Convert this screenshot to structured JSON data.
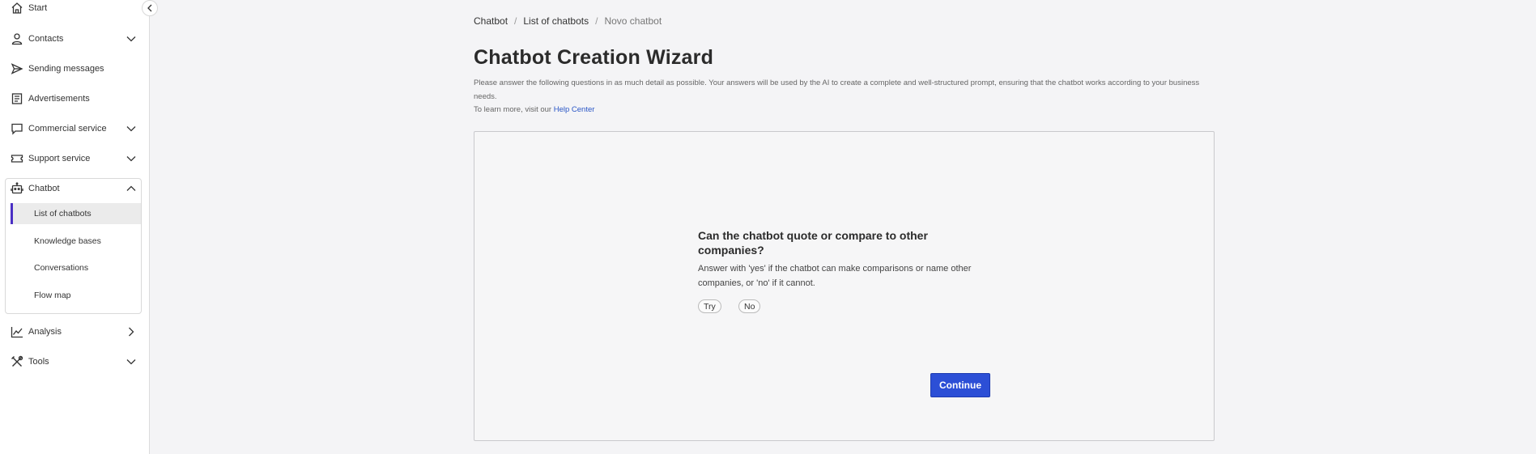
{
  "sidebar": {
    "items": [
      {
        "label": "Start",
        "icon": "home-icon"
      },
      {
        "label": "Contacts",
        "icon": "user-icon"
      },
      {
        "label": "Sending messages",
        "icon": "send-icon"
      },
      {
        "label": "Advertisements",
        "icon": "document-icon"
      },
      {
        "label": "Commercial service",
        "icon": "chat-icon"
      },
      {
        "label": "Support service",
        "icon": "ticket-icon"
      },
      {
        "label": "Chatbot",
        "icon": "robot-icon"
      },
      {
        "label": "Analysis",
        "icon": "chart-icon"
      },
      {
        "label": "Tools",
        "icon": "tools-icon"
      }
    ],
    "chatbot_subitems": [
      {
        "label": "List of chatbots",
        "active": true
      },
      {
        "label": "Knowledge bases"
      },
      {
        "label": "Conversations"
      },
      {
        "label": "Flow map"
      }
    ]
  },
  "breadcrumb": [
    "Chatbot",
    "List of chatbots",
    "Novo chatbot"
  ],
  "main": {
    "title": "Chatbot Creation Wizard",
    "intro_line1": "Please answer the following questions in as much detail as possible. Your answers will be used by the AI to create a complete and well-structured prompt, ensuring that the chatbot works according to your business needs.",
    "intro_line2_prefix": "To learn more, visit our",
    "help_link": "Help Center"
  },
  "wizard": {
    "question": "Can the chatbot quote or compare to other companies?",
    "hint": "Answer with 'yes' if the chatbot can make comparisons or name other companies, or 'no' if it cannot.",
    "options": [
      "Try",
      "No"
    ],
    "continue_label": "Continue"
  },
  "colors": {
    "accent": "#2c4fd6",
    "active_indicator": "#4a2fc4",
    "link": "#2a56c6"
  }
}
